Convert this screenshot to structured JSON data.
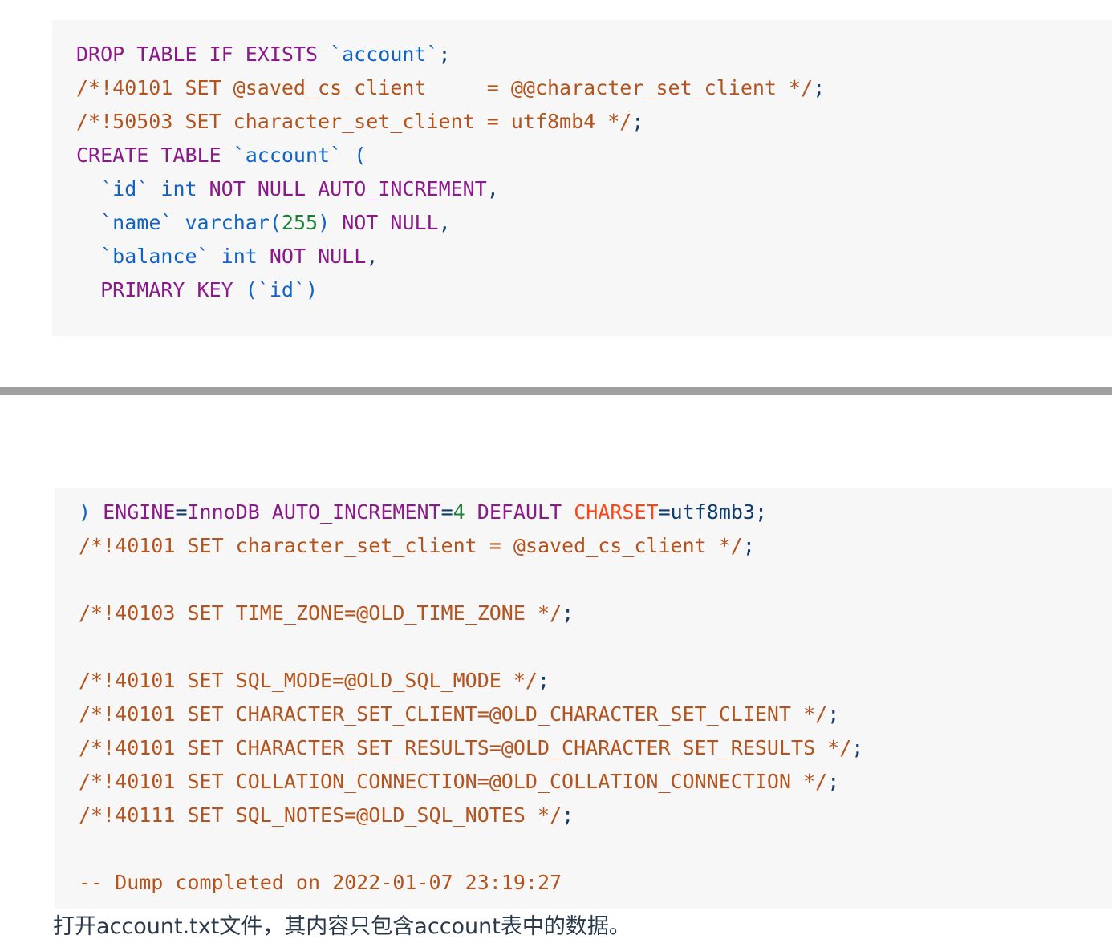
{
  "document": {
    "type": "mysql-dump-code-listing",
    "caption": "打开account.txt文件，其内容只包含account表中的数据。"
  },
  "colors": {
    "code_background": "#f7f7f7",
    "keyword": "#8a1a8a",
    "identifier": "#1063c4",
    "number": "#1a7f37",
    "comment": "#b3531d",
    "charset_highlight": "#fa4616",
    "punctuation": "#0e3b6b",
    "divider": "#a0a0a0",
    "caption_text": "#2b3a4a"
  },
  "code_block_1": {
    "lines": [
      {
        "id": "drop-table",
        "tokens": [
          {
            "t": "DROP TABLE IF EXISTS ",
            "c": "keyword"
          },
          {
            "t": "`account`",
            "c": "ident"
          },
          {
            "t": ";",
            "c": "punct"
          }
        ]
      },
      {
        "id": "set-saved-cs-client",
        "tokens": [
          {
            "t": "/*!40101 SET @saved_cs_client     = @@character_set_client */",
            "c": "comment"
          },
          {
            "t": ";",
            "c": "punct"
          }
        ]
      },
      {
        "id": "set-character-set-client",
        "tokens": [
          {
            "t": "/*!50503 SET character_set_client = utf8mb4 */",
            "c": "comment"
          },
          {
            "t": ";",
            "c": "punct"
          }
        ]
      },
      {
        "id": "create-table",
        "tokens": [
          {
            "t": "CREATE TABLE ",
            "c": "keyword"
          },
          {
            "t": "`account`",
            "c": "ident"
          },
          {
            "t": " ",
            "c": "plain"
          },
          {
            "t": "(",
            "c": "paren"
          }
        ]
      },
      {
        "id": "column-id",
        "tokens": [
          {
            "t": "  ",
            "c": "plain"
          },
          {
            "t": "`id`",
            "c": "ident"
          },
          {
            "t": " ",
            "c": "plain"
          },
          {
            "t": "int",
            "c": "type"
          },
          {
            "t": " ",
            "c": "plain"
          },
          {
            "t": "NOT NULL AUTO_INCREMENT",
            "c": "keyword"
          },
          {
            "t": ",",
            "c": "punct"
          }
        ]
      },
      {
        "id": "column-name",
        "tokens": [
          {
            "t": "  ",
            "c": "plain"
          },
          {
            "t": "`name`",
            "c": "ident"
          },
          {
            "t": " ",
            "c": "plain"
          },
          {
            "t": "varchar",
            "c": "type"
          },
          {
            "t": "(",
            "c": "paren"
          },
          {
            "t": "255",
            "c": "number"
          },
          {
            "t": ")",
            "c": "paren"
          },
          {
            "t": " ",
            "c": "plain"
          },
          {
            "t": "NOT NULL",
            "c": "keyword"
          },
          {
            "t": ",",
            "c": "punct"
          }
        ]
      },
      {
        "id": "column-balance",
        "tokens": [
          {
            "t": "  ",
            "c": "plain"
          },
          {
            "t": "`balance`",
            "c": "ident"
          },
          {
            "t": " ",
            "c": "plain"
          },
          {
            "t": "int",
            "c": "type"
          },
          {
            "t": " ",
            "c": "plain"
          },
          {
            "t": "NOT NULL",
            "c": "keyword"
          },
          {
            "t": ",",
            "c": "punct"
          }
        ]
      },
      {
        "id": "primary-key",
        "tokens": [
          {
            "t": "  ",
            "c": "plain"
          },
          {
            "t": "PRIMARY KEY ",
            "c": "keyword"
          },
          {
            "t": "(",
            "c": "paren"
          },
          {
            "t": "`id`",
            "c": "ident"
          },
          {
            "t": ")",
            "c": "paren"
          }
        ]
      }
    ]
  },
  "code_block_2": {
    "lines": [
      {
        "id": "engine-line",
        "tokens": [
          {
            "t": ")",
            "c": "paren"
          },
          {
            "t": " ",
            "c": "plain"
          },
          {
            "t": "ENGINE",
            "c": "keyword"
          },
          {
            "t": "=",
            "c": "punct"
          },
          {
            "t": "InnoDB",
            "c": "keyword"
          },
          {
            "t": " ",
            "c": "plain"
          },
          {
            "t": "AUTO_INCREMENT",
            "c": "keyword"
          },
          {
            "t": "=",
            "c": "punct"
          },
          {
            "t": "4",
            "c": "number"
          },
          {
            "t": " ",
            "c": "plain"
          },
          {
            "t": "DEFAULT",
            "c": "keyword"
          },
          {
            "t": " ",
            "c": "plain"
          },
          {
            "t": "CHARSET",
            "c": "charset"
          },
          {
            "t": "=",
            "c": "punct"
          },
          {
            "t": "utf8mb3",
            "c": "value"
          },
          {
            "t": ";",
            "c": "punct"
          }
        ]
      },
      {
        "id": "restore-cs-client",
        "tokens": [
          {
            "t": "/*!40101 SET character_set_client = @saved_cs_client */",
            "c": "comment"
          },
          {
            "t": ";",
            "c": "punct"
          }
        ]
      },
      {
        "id": "blank-1",
        "blank": true
      },
      {
        "id": "restore-time-zone",
        "tokens": [
          {
            "t": "/*!40103 SET TIME_ZONE=@OLD_TIME_ZONE */",
            "c": "comment"
          },
          {
            "t": ";",
            "c": "punct"
          }
        ]
      },
      {
        "id": "blank-2",
        "blank": true
      },
      {
        "id": "restore-sql-mode",
        "tokens": [
          {
            "t": "/*!40101 SET SQL_MODE=@OLD_SQL_MODE */",
            "c": "comment"
          },
          {
            "t": ";",
            "c": "punct"
          }
        ]
      },
      {
        "id": "restore-character-set-client",
        "tokens": [
          {
            "t": "/*!40101 SET CHARACTER_SET_CLIENT=@OLD_CHARACTER_SET_CLIENT */",
            "c": "comment"
          },
          {
            "t": ";",
            "c": "punct"
          }
        ]
      },
      {
        "id": "restore-character-set-results",
        "tokens": [
          {
            "t": "/*!40101 SET CHARACTER_SET_RESULTS=@OLD_CHARACTER_SET_RESULTS */",
            "c": "comment"
          },
          {
            "t": ";",
            "c": "punct"
          }
        ]
      },
      {
        "id": "restore-collation-connection",
        "tokens": [
          {
            "t": "/*!40101 SET COLLATION_CONNECTION=@OLD_COLLATION_CONNECTION */",
            "c": "comment"
          },
          {
            "t": ";",
            "c": "punct"
          }
        ]
      },
      {
        "id": "restore-sql-notes",
        "tokens": [
          {
            "t": "/*!40111 SET SQL_NOTES=@OLD_SQL_NOTES */",
            "c": "comment"
          },
          {
            "t": ";",
            "c": "punct"
          }
        ]
      },
      {
        "id": "blank-3",
        "blank": true
      },
      {
        "id": "dump-completed",
        "tokens": [
          {
            "t": "-- Dump completed on 2022-01-07 23:19:27",
            "c": "comment"
          }
        ]
      }
    ]
  }
}
